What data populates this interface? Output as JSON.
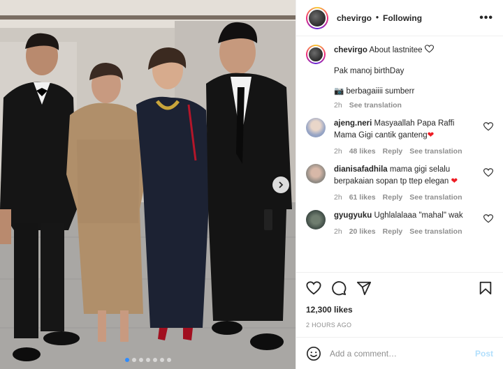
{
  "header": {
    "username": "chevirgo",
    "separator": "•",
    "follow_status": "Following",
    "more_label": "•••"
  },
  "caption": {
    "username": "chevirgo",
    "text": "About lastnitee",
    "emoji": "heart-outline-icon",
    "line2": "Pak manoj birthDay",
    "line3": "📷 berbagaiiii sumberr",
    "time": "2h",
    "translate": "See translation"
  },
  "comments": [
    {
      "username": "ajeng.neri",
      "text": "Masyaallah Papa Raffi Mama Gigi cantik ganteng",
      "emoji": "red-heart",
      "time": "2h",
      "likes": "48 likes",
      "reply": "Reply",
      "translate": "See translation"
    },
    {
      "username": "dianisafadhila",
      "text": "mama gigi selalu berpakaian sopan tp ttep elegan",
      "emoji": "red-heart",
      "time": "2h",
      "likes": "61 likes",
      "reply": "Reply",
      "translate": "See translation"
    },
    {
      "username": "gyugyuku",
      "text": "Ughlalalaaa \"mahal\" wak",
      "emoji": "",
      "time": "2h",
      "likes": "20 likes",
      "reply": "Reply",
      "translate": "See translation"
    }
  ],
  "stats": {
    "likes": "12,300 likes",
    "posted": "2 HOURS AGO"
  },
  "composer": {
    "placeholder": "Add a comment…",
    "post_label": "Post"
  },
  "carousel": {
    "total": 7,
    "active_index": 0
  },
  "colors": {
    "link_blue": "#0095f6",
    "post_disabled": "#b2dffc",
    "muted": "#8e8e8e",
    "heart_red": "#ed1c24",
    "active_dot": "#2f8cff"
  }
}
